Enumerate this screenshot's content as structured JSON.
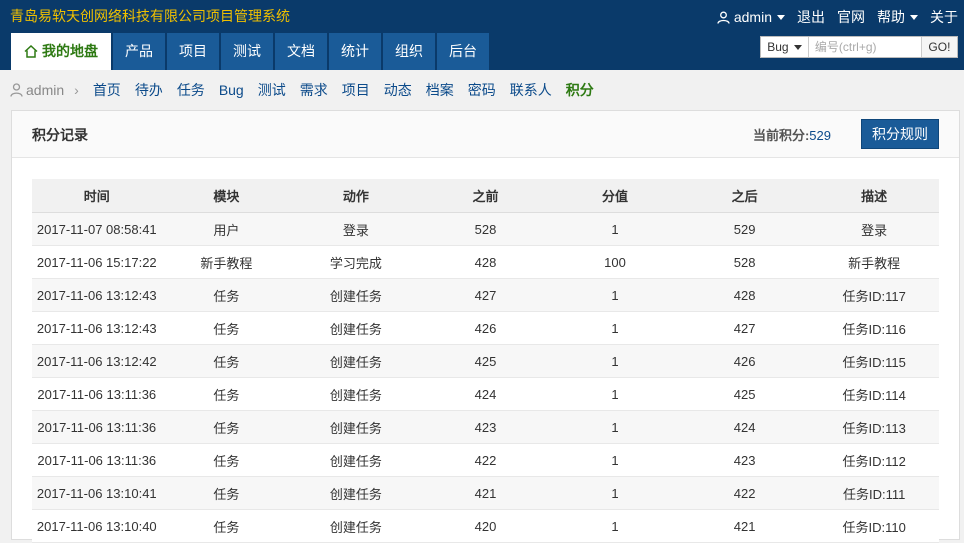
{
  "header": {
    "app_title": "青岛易软天创网络科技有限公司项目管理系统",
    "user": "admin",
    "logout": "退出",
    "website": "官网",
    "help": "帮助",
    "about": "关于"
  },
  "nav": {
    "tabs": [
      {
        "label": "我的地盘"
      },
      {
        "label": "产品"
      },
      {
        "label": "项目"
      },
      {
        "label": "测试"
      },
      {
        "label": "文档"
      },
      {
        "label": "统计"
      },
      {
        "label": "组织"
      },
      {
        "label": "后台"
      }
    ]
  },
  "search": {
    "type": "Bug",
    "placeholder": "编号(ctrl+g)",
    "go": "GO!"
  },
  "subnav": {
    "user": "admin",
    "items": [
      {
        "label": "首页"
      },
      {
        "label": "待办"
      },
      {
        "label": "任务"
      },
      {
        "label": "Bug"
      },
      {
        "label": "测试"
      },
      {
        "label": "需求"
      },
      {
        "label": "项目"
      },
      {
        "label": "动态"
      },
      {
        "label": "档案"
      },
      {
        "label": "密码"
      },
      {
        "label": "联系人"
      },
      {
        "label": "积分"
      }
    ]
  },
  "panel": {
    "title": "积分记录",
    "current_label": "当前积分:",
    "current_value": "529",
    "rules_button": "积分规则"
  },
  "table": {
    "headers": [
      "时间",
      "模块",
      "动作",
      "之前",
      "分值",
      "之后",
      "描述"
    ],
    "rows": [
      [
        "2017-11-07 08:58:41",
        "用户",
        "登录",
        "528",
        "1",
        "529",
        "登录"
      ],
      [
        "2017-11-06 15:17:22",
        "新手教程",
        "学习完成",
        "428",
        "100",
        "528",
        "新手教程"
      ],
      [
        "2017-11-06 13:12:43",
        "任务",
        "创建任务",
        "427",
        "1",
        "428",
        "任务ID:117"
      ],
      [
        "2017-11-06 13:12:43",
        "任务",
        "创建任务",
        "426",
        "1",
        "427",
        "任务ID:116"
      ],
      [
        "2017-11-06 13:12:42",
        "任务",
        "创建任务",
        "425",
        "1",
        "426",
        "任务ID:115"
      ],
      [
        "2017-11-06 13:11:36",
        "任务",
        "创建任务",
        "424",
        "1",
        "425",
        "任务ID:114"
      ],
      [
        "2017-11-06 13:11:36",
        "任务",
        "创建任务",
        "423",
        "1",
        "424",
        "任务ID:113"
      ],
      [
        "2017-11-06 13:11:36",
        "任务",
        "创建任务",
        "422",
        "1",
        "423",
        "任务ID:112"
      ],
      [
        "2017-11-06 13:10:41",
        "任务",
        "创建任务",
        "421",
        "1",
        "422",
        "任务ID:111"
      ],
      [
        "2017-11-06 13:10:40",
        "任务",
        "创建任务",
        "420",
        "1",
        "421",
        "任务ID:110"
      ]
    ]
  }
}
